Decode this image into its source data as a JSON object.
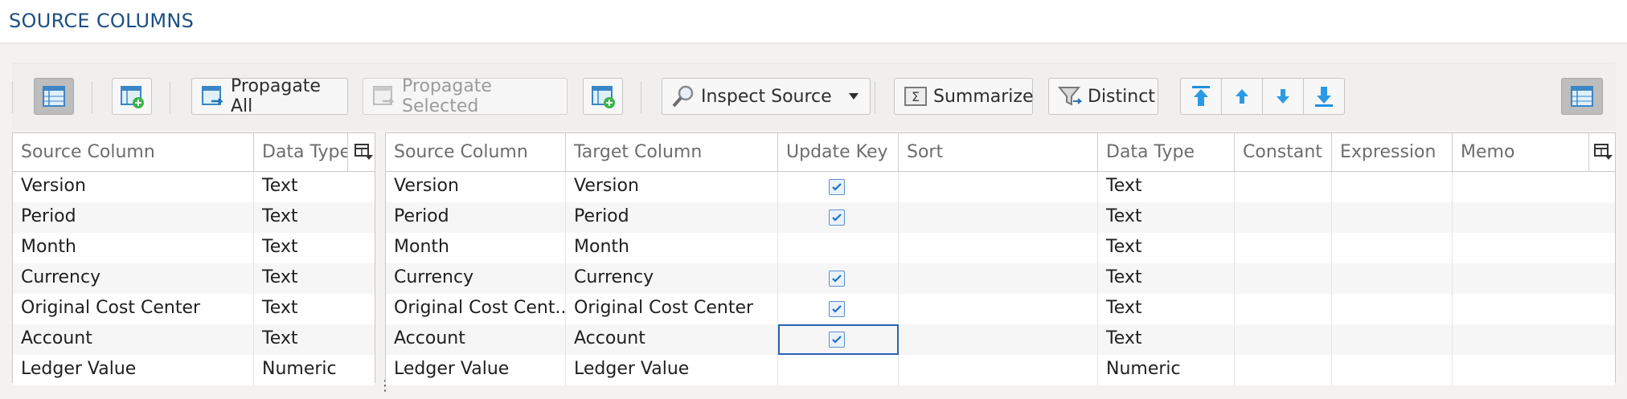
{
  "header": {
    "title": "SOURCE COLUMNS"
  },
  "toolbar": {
    "propagate_all": "Propagate All",
    "propagate_selected": "Propagate Selected",
    "inspect_source": "Inspect Source",
    "summarize": "Summarize",
    "distinct": "Distinct"
  },
  "left_grid": {
    "columns": [
      "Source Column",
      "Data Type"
    ],
    "rows": [
      {
        "source": "Version",
        "type": "Text"
      },
      {
        "source": "Period",
        "type": "Text"
      },
      {
        "source": "Month",
        "type": "Text"
      },
      {
        "source": "Currency",
        "type": "Text"
      },
      {
        "source": "Original Cost Center",
        "type": "Text"
      },
      {
        "source": "Account",
        "type": "Text"
      },
      {
        "source": "Ledger Value",
        "type": "Numeric"
      }
    ]
  },
  "right_grid": {
    "columns": [
      "Source Column",
      "Target Column",
      "Update Key",
      "Sort",
      "Data Type",
      "Constant",
      "Expression",
      "Memo"
    ],
    "rows": [
      {
        "source": "Version",
        "target": "Version",
        "update_key": true,
        "sort": "",
        "type": "Text",
        "constant": "",
        "expression": "",
        "memo": ""
      },
      {
        "source": "Period",
        "target": "Period",
        "update_key": true,
        "sort": "",
        "type": "Text",
        "constant": "",
        "expression": "",
        "memo": ""
      },
      {
        "source": "Month",
        "target": "Month",
        "update_key": false,
        "sort": "",
        "type": "Text",
        "constant": "",
        "expression": "",
        "memo": ""
      },
      {
        "source": "Currency",
        "target": "Currency",
        "update_key": true,
        "sort": "",
        "type": "Text",
        "constant": "",
        "expression": "",
        "memo": ""
      },
      {
        "source": "Original Cost Cent...",
        "target": "Original Cost Center",
        "update_key": true,
        "sort": "",
        "type": "Text",
        "constant": "",
        "expression": "",
        "memo": ""
      },
      {
        "source": "Account",
        "target": "Account",
        "update_key": true,
        "sort": "",
        "type": "Text",
        "constant": "",
        "expression": "",
        "memo": ""
      },
      {
        "source": "Ledger Value",
        "target": "Ledger Value",
        "update_key": false,
        "sort": "",
        "type": "Numeric",
        "constant": "",
        "expression": "",
        "memo": ""
      }
    ]
  }
}
